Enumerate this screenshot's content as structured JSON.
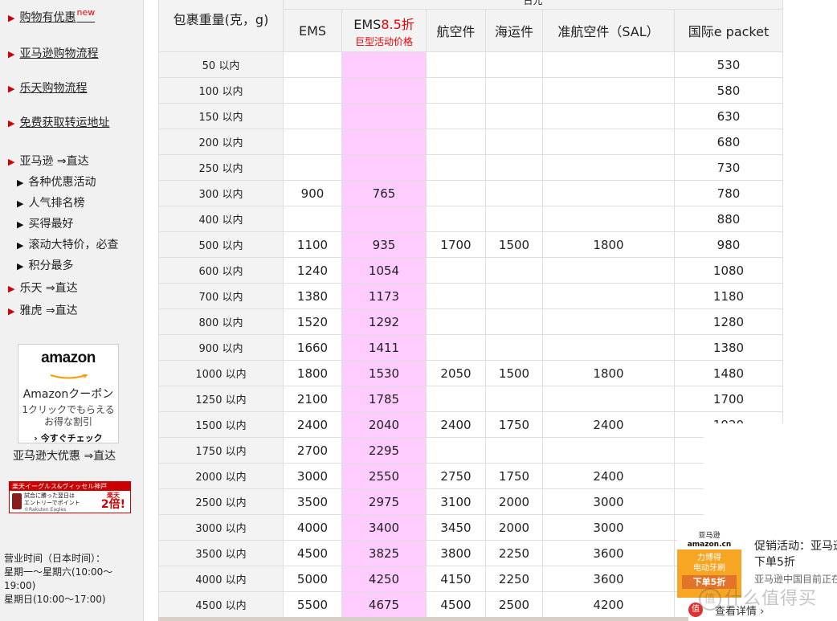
{
  "sidebar": {
    "main_links": [
      {
        "label": "购物有优惠",
        "badge": "new"
      },
      {
        "label": "亚马逊购物流程"
      },
      {
        "label": "乐天购物流程"
      },
      {
        "label": "免费获取转运地址"
      }
    ],
    "amazon_link": "亚马逊 ⇒直达",
    "amazon_sub": [
      "各种优惠活动",
      "人气排名榜",
      "买得最好",
      "滚动大特价，必查",
      "积分最多"
    ],
    "rakuten_link": "乐天 ⇒直达",
    "yahoo_link": "雅虎 ⇒直达",
    "amazon_ad": {
      "logo": "amazon",
      "title": "Amazonクーポン",
      "line1": "1クリックでもらえる",
      "line2": "お得な割引",
      "cta": "今すぐチェック",
      "privacy": "プライバシーについて"
    },
    "amazon_promo": "亚马逊大优惠 ⇒直达",
    "rakuten_banner": {
      "top": "楽天イーグルス&ヴィッセル神戸",
      "mid1": "試合に勝った翌日は",
      "mid2": "エントリーでポイント",
      "foot": "©Rakuten Eagles",
      "badge_top": "楽天",
      "badge_big": "2倍!"
    },
    "hours": {
      "title": "营业时间（日本时间）：",
      "weekday": "星期一～星期六(10:00～",
      "weekday_end": "19:00)",
      "sunday": "星期日(10:00～17:00)"
    }
  },
  "table": {
    "group_header": "日元",
    "weight_header": "包裹重量(克，g)",
    "columns": {
      "ems": "EMS",
      "ems85_prefix": "EMS",
      "ems85_discount": "8.5折",
      "ems85_sub": "巨型活动价格",
      "air": "航空件",
      "sea": "海运件",
      "sal": "准航空件（SAL）",
      "epacket": "国际e packet"
    },
    "rows": [
      {
        "w": "50 以内",
        "ems": "",
        "ems85": "",
        "air": "",
        "sea": "",
        "sal": "",
        "ep": "530"
      },
      {
        "w": "100 以内",
        "ems": "",
        "ems85": "",
        "air": "",
        "sea": "",
        "sal": "",
        "ep": "580"
      },
      {
        "w": "150 以内",
        "ems": "",
        "ems85": "",
        "air": "",
        "sea": "",
        "sal": "",
        "ep": "630"
      },
      {
        "w": "200 以内",
        "ems": "",
        "ems85": "",
        "air": "",
        "sea": "",
        "sal": "",
        "ep": "680"
      },
      {
        "w": "250 以内",
        "ems": "",
        "ems85": "",
        "air": "",
        "sea": "",
        "sal": "",
        "ep": "730"
      },
      {
        "w": "300 以内",
        "ems": "900",
        "ems85": "765",
        "air": "",
        "sea": "",
        "sal": "",
        "ep": "780"
      },
      {
        "w": "400 以内",
        "ems": "",
        "ems85": "",
        "air": "",
        "sea": "",
        "sal": "",
        "ep": "880"
      },
      {
        "w": "500 以内",
        "ems": "1100",
        "ems85": "935",
        "air": "1700",
        "sea": "1500",
        "sal": "1800",
        "ep": "980"
      },
      {
        "w": "600 以内",
        "ems": "1240",
        "ems85": "1054",
        "air": "",
        "sea": "",
        "sal": "",
        "ep": "1080"
      },
      {
        "w": "700 以内",
        "ems": "1380",
        "ems85": "1173",
        "air": "",
        "sea": "",
        "sal": "",
        "ep": "1180"
      },
      {
        "w": "800 以内",
        "ems": "1520",
        "ems85": "1292",
        "air": "",
        "sea": "",
        "sal": "",
        "ep": "1280"
      },
      {
        "w": "900 以内",
        "ems": "1660",
        "ems85": "1411",
        "air": "",
        "sea": "",
        "sal": "",
        "ep": "1380"
      },
      {
        "w": "1000 以内",
        "ems": "1800",
        "ems85": "1530",
        "air": "2050",
        "sea": "1500",
        "sal": "1800",
        "ep": "1480"
      },
      {
        "w": "1250 以内",
        "ems": "2100",
        "ems85": "1785",
        "air": "",
        "sea": "",
        "sal": "",
        "ep": "1700"
      },
      {
        "w": "1500 以内",
        "ems": "2400",
        "ems85": "2040",
        "air": "2400",
        "sea": "1750",
        "sal": "2400",
        "ep": "1920"
      },
      {
        "w": "1750 以内",
        "ems": "2700",
        "ems85": "2295",
        "air": "",
        "sea": "",
        "sal": "",
        "ep": ""
      },
      {
        "w": "2000 以内",
        "ems": "3000",
        "ems85": "2550",
        "air": "2750",
        "sea": "1750",
        "sal": "2400",
        "ep": ""
      },
      {
        "w": "2500 以内",
        "ems": "3500",
        "ems85": "2975",
        "air": "3100",
        "sea": "2000",
        "sal": "3000",
        "ep": ""
      },
      {
        "w": "3000 以内",
        "ems": "4000",
        "ems85": "3400",
        "air": "3450",
        "sea": "2000",
        "sal": "3000",
        "ep": ""
      },
      {
        "w": "3500 以内",
        "ems": "4500",
        "ems85": "3825",
        "air": "3800",
        "sea": "2250",
        "sal": "3600",
        "ep": ""
      },
      {
        "w": "4000 以内",
        "ems": "5000",
        "ems85": "4250",
        "air": "4150",
        "sea": "2250",
        "sal": "3600",
        "ep": ""
      },
      {
        "w": "4500 以内",
        "ems": "5500",
        "ems85": "4675",
        "air": "4500",
        "sea": "2500",
        "sal": "4200",
        "ep": ""
      }
    ]
  },
  "popup": {
    "thumb_brand_cn": "亚马逊",
    "thumb_brand": "amazon.cn",
    "thumb_line1": "力博得",
    "thumb_line2": "电动牙刷",
    "thumb_cta": "下单5折",
    "title": "促销活动：亚马逊",
    "line2": "下单5折",
    "desc": "亚马逊中国目前正在",
    "details": "查看详情 ›",
    "watermark": "什么值得买"
  },
  "colors": {
    "ems85_bg": "#ffccff",
    "accent_red": "#e00000",
    "header_bg": "#f3f3f3",
    "sidebar_bg": "#f1f1f1"
  }
}
